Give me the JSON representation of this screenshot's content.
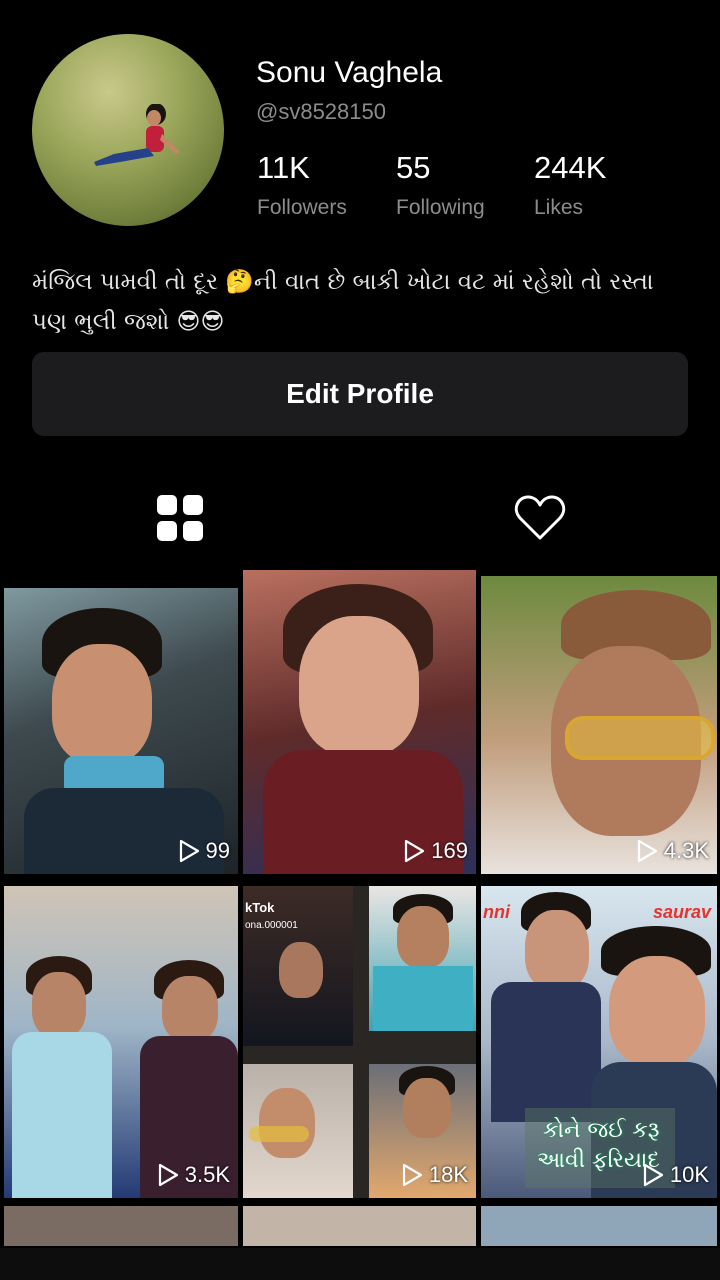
{
  "profile": {
    "name": "Sonu Vaghela",
    "handle": "@sv8528150",
    "bio": "મંજિલ પામવી તો દૂર 🤔ની વાત છે બાકી ખોટા વટ માં રહેશો તો રસ્તા પણ ભુલી જશો 😎😎"
  },
  "stats": {
    "followers": {
      "value": "11K",
      "label": "Followers"
    },
    "following": {
      "value": "55",
      "label": "Following"
    },
    "likes": {
      "value": "244K",
      "label": "Likes"
    }
  },
  "edit_button": "Edit Profile",
  "tabs": [
    {
      "icon": "grid-icon"
    },
    {
      "icon": "heart-icon"
    }
  ],
  "videos": [
    {
      "views": "99"
    },
    {
      "views": "169"
    },
    {
      "views": "4.3K"
    },
    {
      "views": "3.5K"
    },
    {
      "views": "18K",
      "watermark": "kTok",
      "watermark_sub": "ona.000001"
    },
    {
      "views": "10K",
      "overlay_line1": "કોને જઈ કરૂ",
      "overlay_line2": "આવી ફરિયાદ",
      "tag_left": "nni",
      "tag_right": "saurav"
    }
  ]
}
